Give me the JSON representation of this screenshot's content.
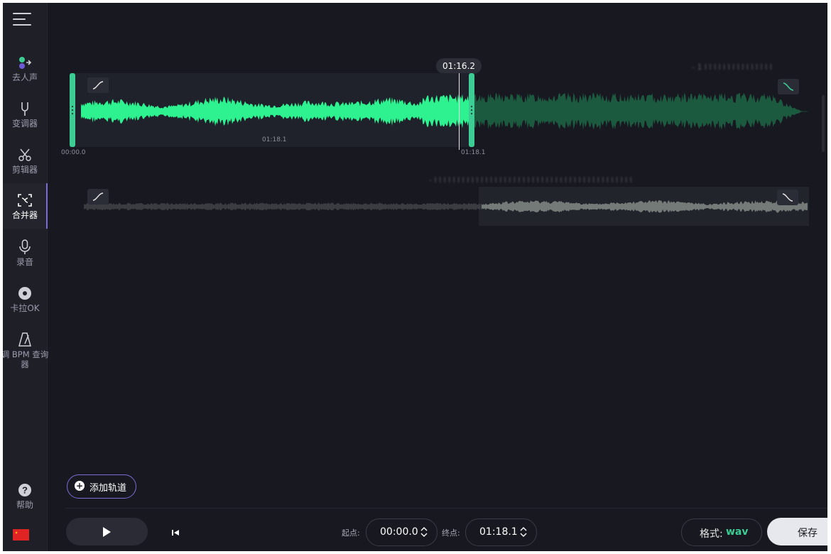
{
  "sidebar": {
    "items": [
      {
        "label": "去人声",
        "icon": "vocal-remover-icon"
      },
      {
        "label": "变调器",
        "icon": "tuning-fork-icon"
      },
      {
        "label": "剪辑器",
        "icon": "scissors-icon"
      },
      {
        "label": "合并器",
        "icon": "merge-icon"
      },
      {
        "label": "录音",
        "icon": "microphone-icon"
      },
      {
        "label": "卡拉OK",
        "icon": "disc-icon"
      },
      {
        "label": "调 BPM 查询器",
        "icon": "metronome-icon"
      }
    ],
    "help_label": "帮助"
  },
  "track1": {
    "playhead_time": "01:16.2",
    "region_duration": "01:18.1",
    "start_label": "00:00.0",
    "end_label": "01:18.1",
    "title_blurred": "- 1 l l l l l l l l l l l l l l l"
  },
  "track2": {
    "title_blurred": "- l l l l l l l l l l l l l l l l l l l l l l l l l l l l l l l l l l l l l l l l l l l"
  },
  "add_track_label": "添加轨道",
  "transport": {
    "start_label": "起点:",
    "start_value": "00:00.0",
    "end_label": "终点:",
    "end_value": "01:18.1"
  },
  "format": {
    "label": "格式:",
    "value": "wav"
  },
  "save_label": "保存",
  "colors": {
    "accent": "#3dcc94",
    "purple": "#7b6cd9",
    "background": "#181920"
  }
}
